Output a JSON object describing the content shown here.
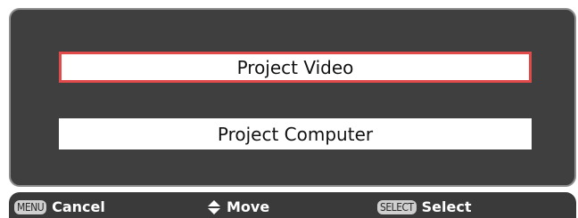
{
  "menu": {
    "options": [
      {
        "label": "Project Video",
        "selected": true
      },
      {
        "label": "Project Computer",
        "selected": false
      }
    ]
  },
  "footer": {
    "cancel_key": "MENU",
    "cancel_label": "Cancel",
    "move_icon": "up-down-arrow-icon",
    "move_label": "Move",
    "select_key": "SELECT",
    "select_label": "Select"
  },
  "colors": {
    "panel_bg": "#3f3f3f",
    "selected_border": "#e04a4a",
    "option_bg": "#ffffff"
  }
}
